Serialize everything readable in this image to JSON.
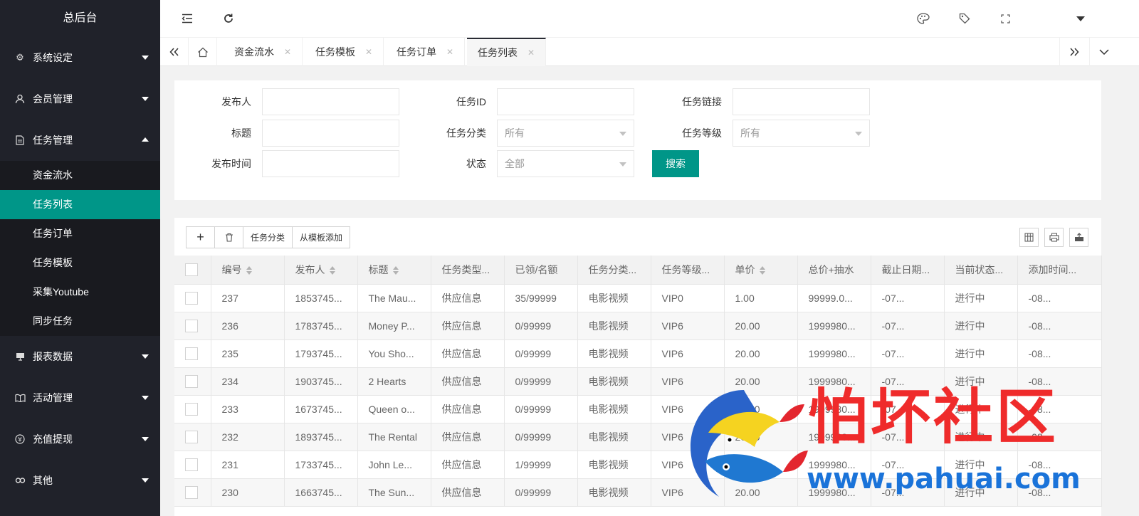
{
  "sidebar": {
    "title": "总后台",
    "items": [
      {
        "label": "系统设定",
        "icon": "gear-icon"
      },
      {
        "label": "会员管理",
        "icon": "user-icon"
      },
      {
        "label": "任务管理",
        "icon": "file-icon"
      }
    ],
    "sub_items": [
      {
        "label": "资金流水"
      },
      {
        "label": "任务列表"
      },
      {
        "label": "任务订单"
      },
      {
        "label": "任务模板"
      },
      {
        "label": "采集Youtube"
      },
      {
        "label": "同步任务"
      }
    ],
    "items_after": [
      {
        "label": "报表数据",
        "icon": "monitor-icon"
      },
      {
        "label": "活动管理",
        "icon": "book-icon"
      },
      {
        "label": "充值提现",
        "icon": "yen-icon"
      },
      {
        "label": "其他",
        "icon": "link-icon"
      }
    ]
  },
  "tabs": [
    {
      "label": "资金流水"
    },
    {
      "label": "任务模板"
    },
    {
      "label": "任务订单"
    },
    {
      "label": "任务列表"
    }
  ],
  "filters": {
    "publisher_label": "发布人",
    "task_id_label": "任务ID",
    "task_link_label": "任务链接",
    "title_label": "标题",
    "category_label": "任务分类",
    "category_value": "所有",
    "level_label": "任务等级",
    "level_value": "所有",
    "time_label": "发布时间",
    "status_label": "状态",
    "status_value": "全部",
    "search_button": "搜索"
  },
  "toolbar": {
    "add": "+",
    "category": "任务分类",
    "from_template": "从模板添加"
  },
  "table": {
    "columns": [
      "编号",
      "发布人",
      "标题",
      "任务类型...",
      "已领/名额",
      "任务分类...",
      "任务等级...",
      "单价",
      "总价+抽水",
      "截止日期...",
      "当前状态...",
      "添加时间..."
    ],
    "rows": [
      [
        "237",
        "1853745...",
        "The Mau...",
        "供应信息",
        "35/99999",
        "电影视频",
        "VIP0",
        "1.00",
        "99999.0...",
        "-07...",
        "进行中",
        "-08..."
      ],
      [
        "236",
        "1783745...",
        "Money P...",
        "供应信息",
        "0/99999",
        "电影视频",
        "VIP6",
        "20.00",
        "1999980...",
        "-07...",
        "进行中",
        "-08..."
      ],
      [
        "235",
        "1793745...",
        "You Sho...",
        "供应信息",
        "0/99999",
        "电影视频",
        "VIP6",
        "20.00",
        "1999980...",
        "-07...",
        "进行中",
        "-08..."
      ],
      [
        "234",
        "1903745...",
        "2 Hearts",
        "供应信息",
        "0/99999",
        "电影视频",
        "VIP6",
        "20.00",
        "1999980...",
        "-07...",
        "进行中",
        "-08..."
      ],
      [
        "233",
        "1673745...",
        "Queen o...",
        "供应信息",
        "0/99999",
        "电影视频",
        "VIP6",
        "20.00",
        "1999980...",
        "-07...",
        "进行中",
        "-08..."
      ],
      [
        "232",
        "1893745...",
        "The Rental",
        "供应信息",
        "0/99999",
        "电影视频",
        "VIP6",
        "20.00",
        "1999980...",
        "-07...",
        "进行中",
        "-08..."
      ],
      [
        "231",
        "1733745...",
        "John Le...",
        "供应信息",
        "1/99999",
        "电影视频",
        "VIP6",
        "20.00",
        "1999980...",
        "-07...",
        "进行中",
        "-08..."
      ],
      [
        "230",
        "1663745...",
        "The Sun...",
        "供应信息",
        "0/99999",
        "电影视频",
        "VIP6",
        "20.00",
        "1999980...",
        "-07...",
        "进行中",
        "-08..."
      ]
    ]
  },
  "watermark": {
    "text": "怕坏社区",
    "url": "www.pahuai.com"
  }
}
